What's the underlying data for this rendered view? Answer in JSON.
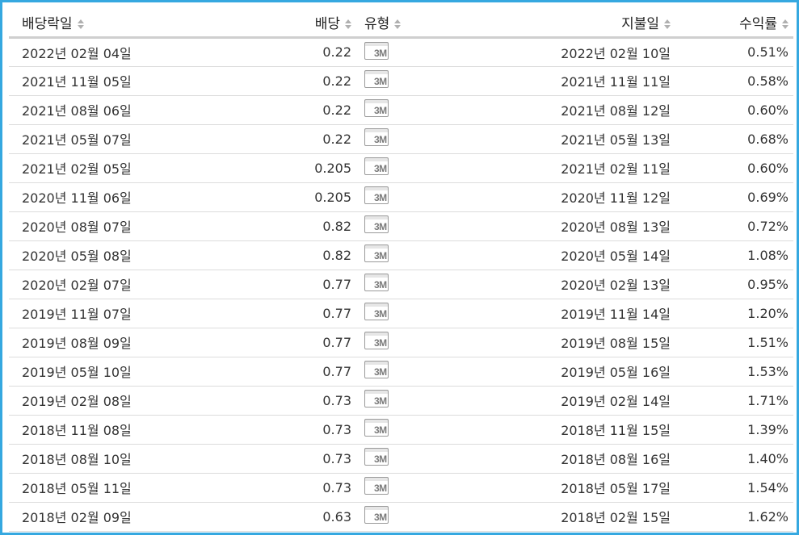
{
  "table": {
    "headers": {
      "ex_date": "배당락일",
      "dividend": "배당",
      "type": "유형",
      "pay_date": "지불일",
      "yield": "수익률"
    },
    "frequency_icon_label": "3M",
    "rows": [
      {
        "ex_date": "2022년 02월 04일",
        "dividend": "0.22",
        "pay_date": "2022년 02월 10일",
        "yield": "0.51%"
      },
      {
        "ex_date": "2021년 11월 05일",
        "dividend": "0.22",
        "pay_date": "2021년 11월 11일",
        "yield": "0.58%"
      },
      {
        "ex_date": "2021년 08월 06일",
        "dividend": "0.22",
        "pay_date": "2021년 08월 12일",
        "yield": "0.60%"
      },
      {
        "ex_date": "2021년 05월 07일",
        "dividend": "0.22",
        "pay_date": "2021년 05월 13일",
        "yield": "0.68%"
      },
      {
        "ex_date": "2021년 02월 05일",
        "dividend": "0.205",
        "pay_date": "2021년 02월 11일",
        "yield": "0.60%"
      },
      {
        "ex_date": "2020년 11월 06일",
        "dividend": "0.205",
        "pay_date": "2020년 11월 12일",
        "yield": "0.69%"
      },
      {
        "ex_date": "2020년 08월 07일",
        "dividend": "0.82",
        "pay_date": "2020년 08월 13일",
        "yield": "0.72%"
      },
      {
        "ex_date": "2020년 05월 08일",
        "dividend": "0.82",
        "pay_date": "2020년 05월 14일",
        "yield": "1.08%"
      },
      {
        "ex_date": "2020년 02월 07일",
        "dividend": "0.77",
        "pay_date": "2020년 02월 13일",
        "yield": "0.95%"
      },
      {
        "ex_date": "2019년 11월 07일",
        "dividend": "0.77",
        "pay_date": "2019년 11월 14일",
        "yield": "1.20%"
      },
      {
        "ex_date": "2019년 08월 09일",
        "dividend": "0.77",
        "pay_date": "2019년 08월 15일",
        "yield": "1.51%"
      },
      {
        "ex_date": "2019년 05월 10일",
        "dividend": "0.77",
        "pay_date": "2019년 05월 16일",
        "yield": "1.53%"
      },
      {
        "ex_date": "2019년 02월 08일",
        "dividend": "0.73",
        "pay_date": "2019년 02월 14일",
        "yield": "1.71%"
      },
      {
        "ex_date": "2018년 11월 08일",
        "dividend": "0.73",
        "pay_date": "2018년 11월 15일",
        "yield": "1.39%"
      },
      {
        "ex_date": "2018년 08월 10일",
        "dividend": "0.73",
        "pay_date": "2018년 08월 16일",
        "yield": "1.40%"
      },
      {
        "ex_date": "2018년 05월 11일",
        "dividend": "0.73",
        "pay_date": "2018년 05월 17일",
        "yield": "1.54%"
      },
      {
        "ex_date": "2018년 02월 09일",
        "dividend": "0.63",
        "pay_date": "2018년 02월 15일",
        "yield": "1.62%"
      }
    ]
  },
  "colors": {
    "frame_border": "#35a8e0",
    "header_rule": "#cfcfcf",
    "row_divider": "#dcdcdc"
  }
}
